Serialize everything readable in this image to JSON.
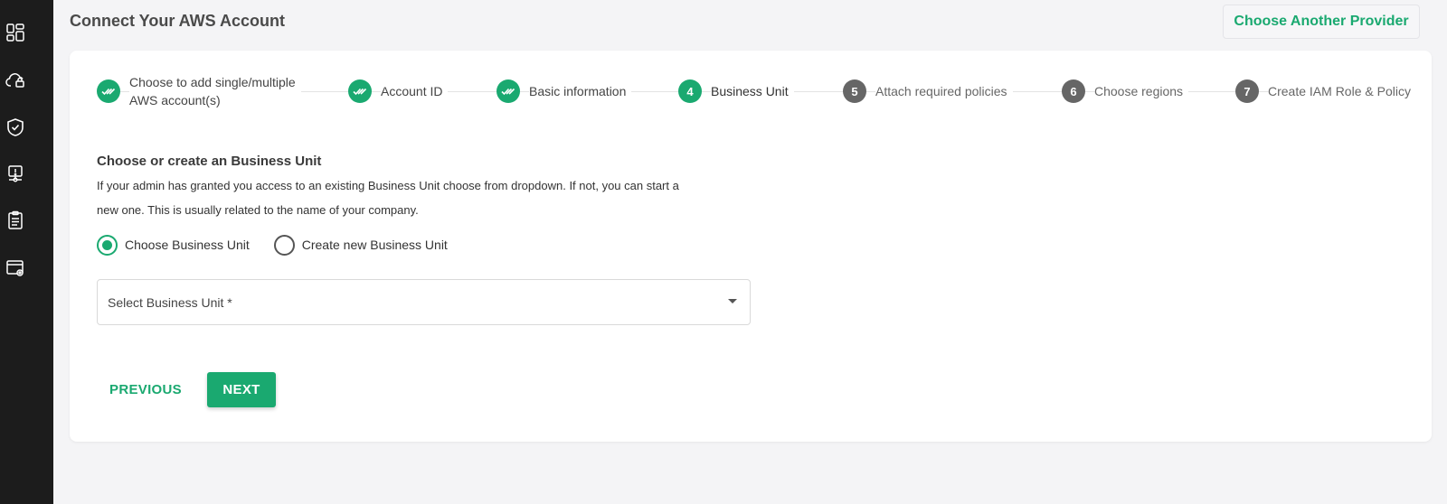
{
  "sidebar": {
    "items": [
      {
        "icon": "dashboard-icon"
      },
      {
        "icon": "cloud-lock-icon"
      },
      {
        "icon": "shield-check-icon"
      },
      {
        "icon": "alert-monitor-icon"
      },
      {
        "icon": "clipboard-icon"
      },
      {
        "icon": "browser-settings-icon"
      }
    ]
  },
  "header": {
    "title": "Connect Your AWS Account",
    "provider_button": "Choose Another Provider"
  },
  "stepper": {
    "steps": [
      {
        "label_line1": "Choose to add single/multiple",
        "label_line2": "AWS account(s)",
        "status": "done"
      },
      {
        "label": "Account ID",
        "status": "done"
      },
      {
        "label": "Basic information",
        "status": "done"
      },
      {
        "number": "4",
        "label": "Business Unit",
        "status": "active"
      },
      {
        "number": "5",
        "label": "Attach required policies",
        "status": "pending"
      },
      {
        "number": "6",
        "label": "Choose regions",
        "status": "pending"
      },
      {
        "number": "7",
        "label": "Create IAM Role & Policy",
        "status": "pending"
      }
    ]
  },
  "form": {
    "title": "Choose or create an Business Unit",
    "description_line1": "If your admin has granted you access to an existing Business Unit choose from dropdown. If not, you can start a",
    "description_line2": "new one. This is usually related to the name of your company.",
    "radio_options": [
      {
        "label": "Choose Business Unit",
        "checked": true
      },
      {
        "label": "Create new Business Unit",
        "checked": false
      }
    ],
    "select_placeholder": "Select Business Unit *",
    "previous_label": "PREVIOUS",
    "next_label": "NEXT"
  },
  "colors": {
    "accent": "#1aa970",
    "sidebar_bg": "#1c1c1c",
    "page_bg": "#f4f4f6",
    "pending_step": "#666666"
  }
}
